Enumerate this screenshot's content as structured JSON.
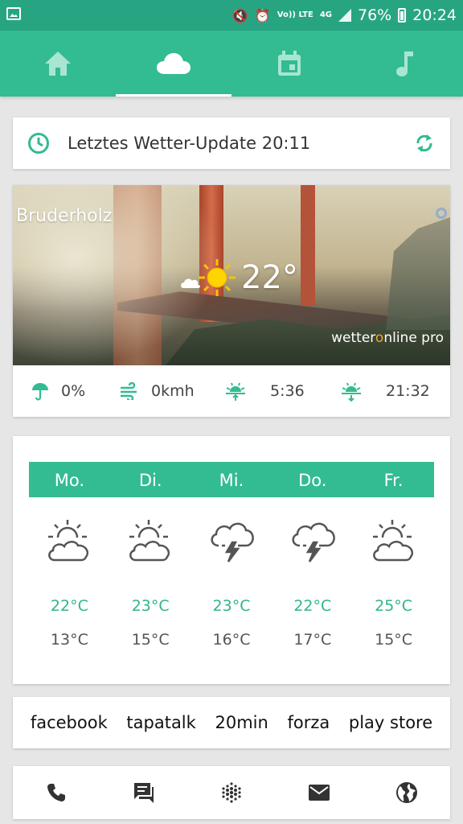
{
  "status_bar": {
    "battery": "76%",
    "time": "20:24",
    "network": "4G",
    "volte": "Vo)) LTE"
  },
  "tabs": [
    {
      "icon": "home-icon"
    },
    {
      "icon": "cloud-icon",
      "active": true
    },
    {
      "icon": "calendar-icon"
    },
    {
      "icon": "music-note-icon"
    }
  ],
  "update": {
    "text": "Letztes Wetter-Update 20:11"
  },
  "weather": {
    "location": "Bruderholz",
    "temperature": "22°",
    "brand_prefix": "wetter",
    "brand_o": "o",
    "brand_suffix": "nline pro",
    "rain": "0%",
    "wind": "0kmh",
    "sunrise": "5:36",
    "sunset": "21:32"
  },
  "forecast": {
    "days": [
      "Mo.",
      "Di.",
      "Mi.",
      "Do.",
      "Fr."
    ],
    "icons": [
      "partly-cloudy-icon",
      "partly-cloudy-icon",
      "thunderstorm-icon",
      "thunderstorm-icon",
      "partly-cloudy-icon"
    ],
    "highs": [
      "22°C",
      "23°C",
      "23°C",
      "22°C",
      "25°C"
    ],
    "lows": [
      "13°C",
      "15°C",
      "16°C",
      "17°C",
      "15°C"
    ]
  },
  "links": [
    "facebook",
    "tapatalk",
    "20min",
    "forza",
    "play store"
  ],
  "bottom_icons": [
    "phone-icon",
    "chat-icon",
    "dots-grid-icon",
    "mail-icon",
    "globe-icon"
  ],
  "colors": {
    "accent": "#33bb92",
    "status_bar": "#27a583",
    "high_temp": "#2fb58d"
  }
}
